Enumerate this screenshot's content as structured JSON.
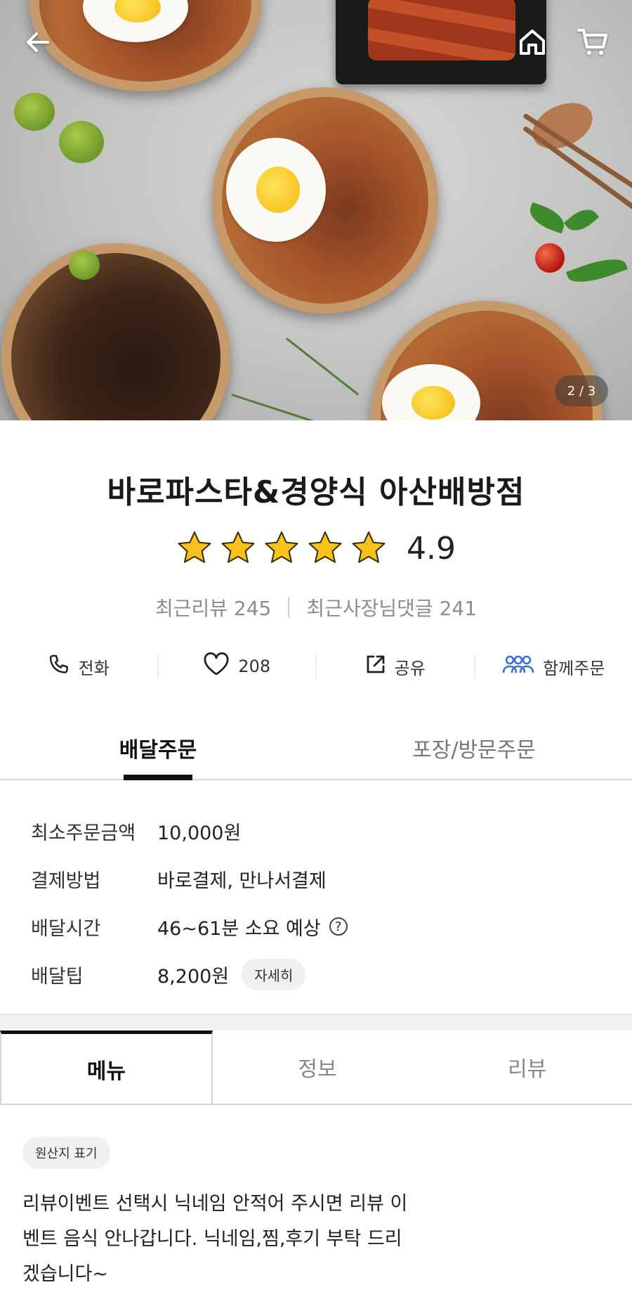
{
  "hero": {
    "page_indicator": "2 / 3",
    "icons": {
      "back": "arrow-left-icon",
      "home": "home-icon",
      "cart": "cart-icon"
    }
  },
  "store": {
    "name": "바로파스타&경양식 아산배방점",
    "rating": {
      "value": "4.9",
      "stars": 5,
      "max_stars": 5,
      "star_color": "#f6c21b"
    },
    "recent_reviews": "최근리뷰 245",
    "recent_owner_replies": "최근사장님댓글 241"
  },
  "actions": [
    {
      "label": "전화",
      "icon": "phone-icon"
    },
    {
      "label": "208",
      "icon": "heart-icon"
    },
    {
      "label": "공유",
      "icon": "share-icon"
    },
    {
      "label": "함께주문",
      "icon": "group-order-icon",
      "icon_color": "#3a6fd8"
    }
  ],
  "order_tabs": [
    {
      "label": "배달주문",
      "active": true
    },
    {
      "label": "포장/방문주문",
      "active": false
    }
  ],
  "delivery_info": {
    "min_order": {
      "label": "최소주문금액",
      "value": "10,000원"
    },
    "payment": {
      "label": "결제방법",
      "value": "바로결제, 만나서결제"
    },
    "time": {
      "label": "배달시간",
      "value": "46~61분 소요 예상",
      "help": "?"
    },
    "tip": {
      "label": "배달팁",
      "value": "8,200원",
      "detail_label": "자세히"
    }
  },
  "main_tabs": [
    {
      "label": "메뉴",
      "active": true
    },
    {
      "label": "정보",
      "active": false
    },
    {
      "label": "리뷰",
      "active": false
    }
  ],
  "menu": {
    "origin_badge": "원산지 표기",
    "notice": "리뷰이벤트 선택시 닉네임 안적어 주시면 리뷰 이벤트 음식 안나갑니다. 닉네임,찜,후기 부탁 드리겠습니다~"
  }
}
